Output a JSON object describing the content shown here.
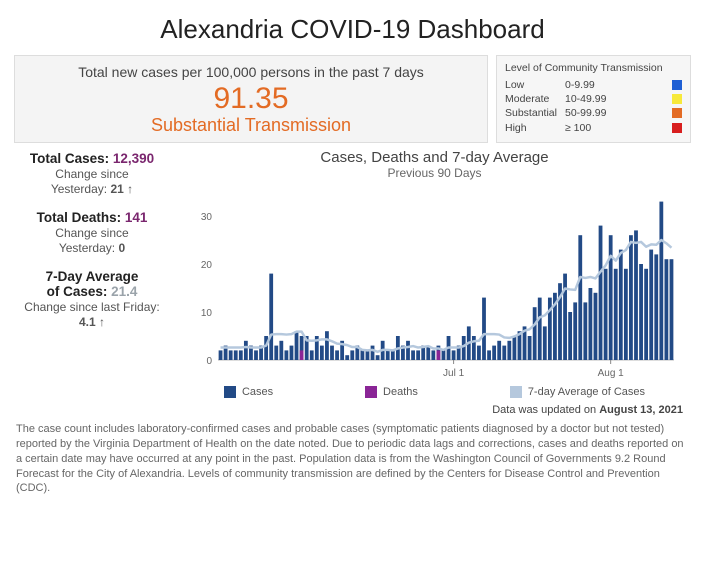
{
  "title": "Alexandria COVID-19 Dashboard",
  "headline": {
    "label": "Total new cases per 100,000 persons in the past 7 days",
    "value": "91.35",
    "status": "Substantial Transmission"
  },
  "transmission_legend": {
    "title": "Level of Community Transmission",
    "levels": [
      {
        "name": "Low",
        "range": "0-9.99"
      },
      {
        "name": "Moderate",
        "range": "10-49.99"
      },
      {
        "name": "Substantial",
        "range": "50-99.99"
      },
      {
        "name": "High",
        "range": "≥ 100"
      }
    ]
  },
  "stats": {
    "total_cases": {
      "label": "Total Cases: ",
      "value": "12,390",
      "sub1": "Change since",
      "sub2": "Yesterday:",
      "change": "21 ↑"
    },
    "total_deaths": {
      "label": "Total Deaths: ",
      "value": "141",
      "sub1": "Change since",
      "sub2": "Yesterday:",
      "change": "0"
    },
    "avg7": {
      "label1": "7-Day Average",
      "label2": "of Cases: ",
      "value": "21.4",
      "sub": "Change since last Friday:",
      "change": "4.1  ↑"
    }
  },
  "chart": {
    "title": "Cases, Deaths and 7-day Average",
    "subtitle": "Previous 90 Days",
    "legend": {
      "cases": "Cases",
      "deaths": "Deaths",
      "avg": "7-day Average of Cases"
    },
    "xlabels": {
      "jul": "Jul 1",
      "aug": "Aug 1"
    }
  },
  "updated": {
    "prefix": "Data was updated on ",
    "date": "August 13, 2021"
  },
  "footnote": "The case count includes laboratory-confirmed cases and probable cases (symptomatic patients diagnosed by a doctor but not tested) reported by the Virginia Department of Health on the date noted. Due to periodic data lags and corrections, cases and deaths reported on a certain date may have occurred at any point in the past. Population data is from the Washington Council of Governments 9.2 Round Forecast for the City of Alexandria. Levels of community transmission are defined by the Centers for Disease Control and Prevention (CDC).",
  "chart_data": {
    "type": "bar",
    "title": "Cases, Deaths and 7-day Average",
    "subtitle": "Previous 90 Days",
    "xlabel": "",
    "ylabel": "",
    "ylim": [
      0,
      35
    ],
    "yticks": [
      0,
      10,
      20,
      30
    ],
    "x_markers": [
      {
        "label": "Jul 1",
        "index": 46
      },
      {
        "label": "Aug 1",
        "index": 77
      }
    ],
    "series": [
      {
        "name": "Cases",
        "color": "#224a86",
        "values": [
          2,
          3,
          2,
          2,
          2,
          4,
          3,
          2,
          3,
          5,
          18,
          3,
          4,
          2,
          3,
          6,
          5,
          5,
          2,
          5,
          3,
          6,
          3,
          2,
          4,
          1,
          2,
          3,
          2,
          2,
          3,
          1,
          4,
          2,
          2,
          5,
          3,
          4,
          2,
          2,
          3,
          3,
          2,
          3,
          2,
          5,
          2,
          3,
          5,
          7,
          5,
          3,
          13,
          2,
          3,
          4,
          3,
          4,
          5,
          6,
          7,
          5,
          11,
          13,
          7,
          13,
          14,
          16,
          18,
          10,
          12,
          26,
          12,
          15,
          14,
          28,
          19,
          26,
          19,
          23,
          19,
          26,
          27,
          20,
          19,
          23,
          22,
          33,
          21,
          21
        ]
      },
      {
        "name": "Deaths",
        "color": "#8a2596",
        "values": [
          0,
          0,
          0,
          0,
          0,
          0,
          0,
          0,
          0,
          0,
          0,
          0,
          0,
          0,
          0,
          0,
          2,
          0,
          0,
          0,
          0,
          0,
          0,
          0,
          0,
          0,
          0,
          0,
          0,
          0,
          0,
          0,
          0,
          0,
          0,
          0,
          0,
          0,
          0,
          0,
          0,
          0,
          0,
          2,
          0,
          0,
          0,
          0,
          0,
          0,
          0,
          0,
          0,
          0,
          0,
          0,
          0,
          0,
          0,
          0,
          0,
          0,
          0,
          0,
          0,
          0,
          0,
          0,
          0,
          0,
          0,
          0,
          0,
          0,
          0,
          0,
          0,
          0,
          0,
          0,
          0,
          0,
          0,
          0,
          0,
          0,
          0,
          0,
          0,
          0
        ]
      },
      {
        "name": "7-day Average of Cases",
        "color": "#b5c8dd",
        "values": [
          2.6,
          2.6,
          2.6,
          2.6,
          2.6,
          2.7,
          2.6,
          2.6,
          2.6,
          3.0,
          5.3,
          5.4,
          5.4,
          5.3,
          5.4,
          5.9,
          5.9,
          4.1,
          4.0,
          4.1,
          4.3,
          4.3,
          3.9,
          3.4,
          3.3,
          3.1,
          2.7,
          2.7,
          2.1,
          2.0,
          2.1,
          1.7,
          2.1,
          2.1,
          2.0,
          2.4,
          2.6,
          2.7,
          2.9,
          2.6,
          2.7,
          2.9,
          2.4,
          2.4,
          2.1,
          2.6,
          2.6,
          2.6,
          2.9,
          3.6,
          3.9,
          4.0,
          5.4,
          5.4,
          5.4,
          5.3,
          4.7,
          4.6,
          4.9,
          5.4,
          6.1,
          6.4,
          7.4,
          8.9,
          9.3,
          10.4,
          11.6,
          13.1,
          14.9,
          14.7,
          14.6,
          17.3,
          17.1,
          17.3,
          17.0,
          18.4,
          19.7,
          21.7,
          20.7,
          22.3,
          22.9,
          24.6,
          24.4,
          24.6,
          23.6,
          24.1,
          24.0,
          25.0,
          24.3,
          23.4
        ]
      }
    ]
  }
}
